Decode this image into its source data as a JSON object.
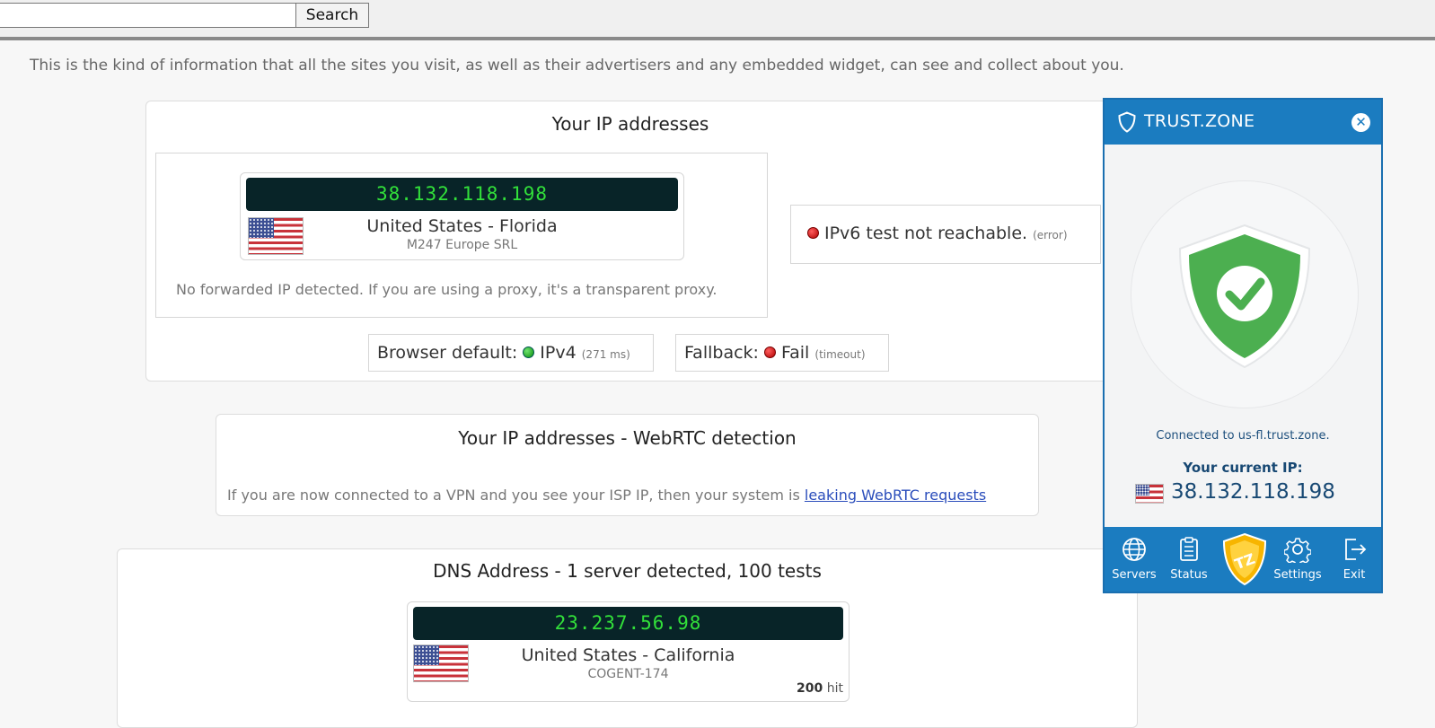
{
  "topbar": {
    "search_value": "",
    "search_button": "Search"
  },
  "intro": "This is the kind of information that all the sites you visit, as well as their advertisers and any embedded widget, can see and collect about you.",
  "ip_panel": {
    "title": "Your IP addresses",
    "ip": "38.132.118.198",
    "location": "United States - Florida",
    "isp": "M247 Europe SRL",
    "forwarded_note": "No forwarded IP detected. If you are using a proxy, it's a transparent proxy.",
    "ipv6_text": "IPv6 test not reachable.",
    "ipv6_status": "(error)",
    "browser_default_label": "Browser default:",
    "browser_default_value": "IPv4",
    "browser_default_time": "(271 ms)",
    "fallback_label": "Fallback:",
    "fallback_value": "Fail",
    "fallback_time": "(timeout)"
  },
  "webrtc_panel": {
    "title": "Your IP addresses - WebRTC detection",
    "note_prefix": "If you are now connected to a VPN and you see your ISP IP, then your system is",
    "note_link": "leaking WebRTC requests"
  },
  "dns_panel": {
    "title": "DNS Address - 1 server detected, 100 tests",
    "ip": "23.237.56.98",
    "location": "United States - California",
    "isp": "COGENT-174",
    "hits_count": "200",
    "hits_label": "hit"
  },
  "trustzone": {
    "brand": "TRUST.ZONE",
    "connected_text": "Connected to us-fl.trust.zone.",
    "ip_label": "Your current IP:",
    "ip": "38.132.118.198",
    "nav": [
      "Servers",
      "Status",
      "Settings",
      "Exit"
    ],
    "accent_color": "#1b7cc0",
    "shield_color": "#4caf50"
  }
}
